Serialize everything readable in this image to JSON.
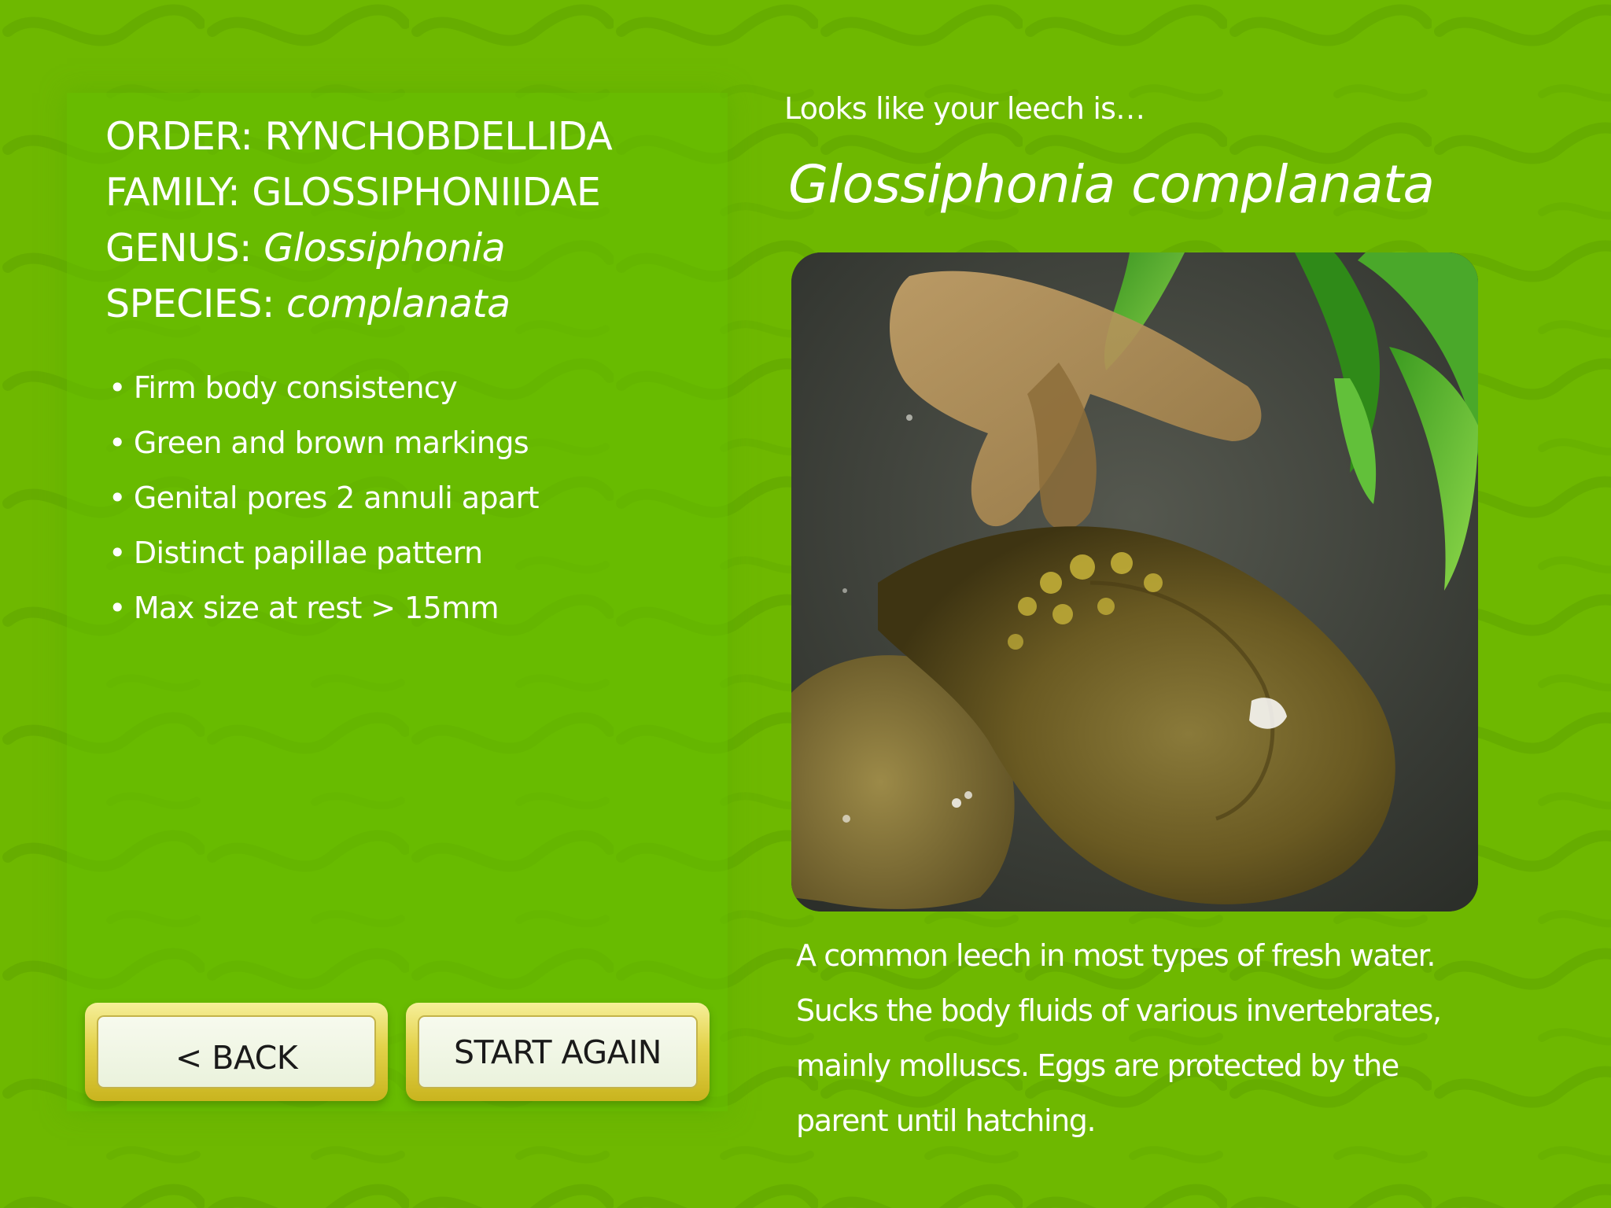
{
  "classification": {
    "order_label": "ORDER:",
    "order_value": "RYNCHOBDELLIDA",
    "family_label": "FAMILY:",
    "family_value": "GLOSSIPHONIIDAE",
    "genus_label": "GENUS:",
    "genus_value": "Glossiphonia",
    "species_label": "SPECIES:",
    "species_value": "complanata"
  },
  "traits": [
    "Firm body consistency",
    "Green and brown markings",
    "Genital pores 2 annuli apart",
    "Distinct papillae pattern",
    "Max size at rest > 15mm"
  ],
  "bullet_glyph": "•",
  "buttons": {
    "back_label": "< BACK",
    "start_again_label": "START AGAIN"
  },
  "result": {
    "intro": "Looks like your leech is…",
    "species_name": "Glossiphonia complanata",
    "description": "A common leech in most types of fresh water. Sucks the body fluids of various invertebrates, mainly molluscs. Eggs are protected by the parent until hatching."
  },
  "colors": {
    "background": "#6eb800",
    "text": "#ffffff",
    "button_frame": "#e3d24a",
    "button_face": "#eef5e2",
    "button_text": "#1a1a1a"
  }
}
